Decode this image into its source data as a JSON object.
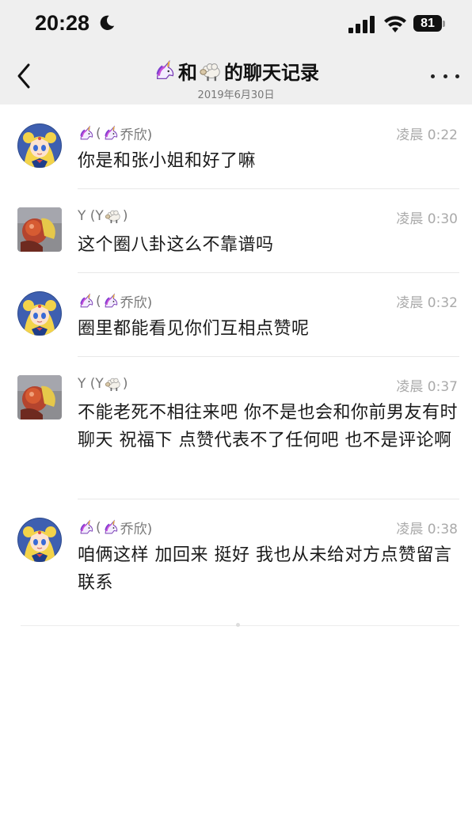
{
  "status_bar": {
    "time": "20:28",
    "battery": "81",
    "icons": [
      "moon-icon",
      "signal-icon",
      "wifi-icon",
      "battery-icon"
    ]
  },
  "nav": {
    "title_part1": "和",
    "title_part2": "的聊天记录",
    "subtitle": "2019年6月30日",
    "icons": [
      "back-icon",
      "unicorn-emoji-icon",
      "sheep-emoji-icon",
      "more-icon"
    ]
  },
  "messages": [
    {
      "sender_prefix": "(",
      "sender_name": "乔欣)",
      "time": "凌晨 0:22",
      "text": "你是和张小姐和好了嘛",
      "avatar": "anime-avatar"
    },
    {
      "sender_prefix": "Y (Y",
      "sender_name": ")",
      "time": "凌晨 0:30",
      "text": "这个圈八卦这么不靠谱吗",
      "avatar": "photo-avatar"
    },
    {
      "sender_prefix": "(",
      "sender_name": "乔欣)",
      "time": "凌晨 0:32",
      "text": "圈里都能看见你们互相点赞呢",
      "avatar": "anime-avatar"
    },
    {
      "sender_prefix": "Y (Y",
      "sender_name": ")",
      "time": "凌晨 0:37",
      "text": "不能老死不相往来吧 你不是也会和你前男友有时聊天 祝福下 点赞代表不了任何吧 也不是评论啊",
      "avatar": "photo-avatar"
    },
    {
      "sender_prefix": "(",
      "sender_name": "乔欣)",
      "time": "凌晨 0:38",
      "text": "咱俩这样 加回来 挺好  我也从未给对方点赞留言联系",
      "avatar": "anime-avatar"
    }
  ],
  "colors": {
    "header_bg": "#efefef",
    "text": "#1a1a1a",
    "meta": "#aaaaaa",
    "unicorn": "#9b59d0"
  }
}
